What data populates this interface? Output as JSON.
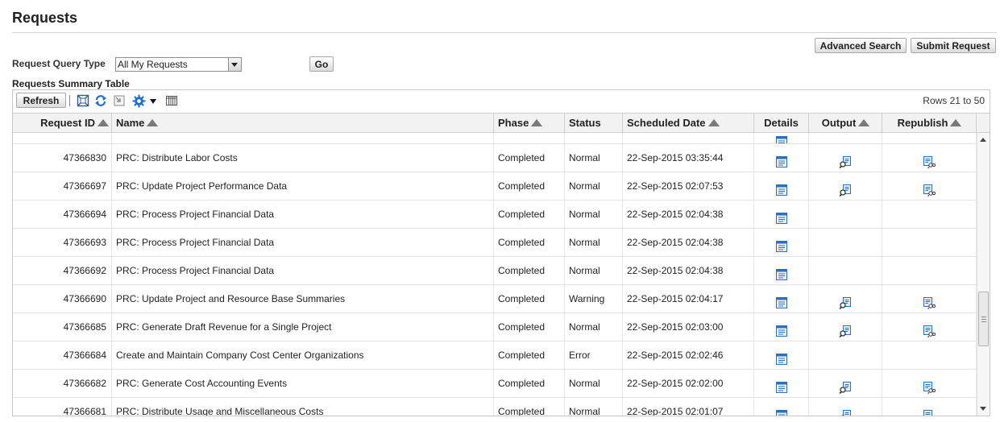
{
  "page": {
    "title": "Requests"
  },
  "actions": {
    "advanced_search": "Advanced Search",
    "submit_request": "Submit Request"
  },
  "query": {
    "label": "Request Query Type",
    "selected": "All My Requests",
    "go_label": "Go"
  },
  "table": {
    "title": "Requests Summary Table",
    "refresh_label": "Refresh",
    "rows_range": "Rows 21 to 50",
    "columns": {
      "request_id": "Request ID",
      "name": "Name",
      "phase": "Phase",
      "status": "Status",
      "scheduled_date": "Scheduled Date",
      "details": "Details",
      "output": "Output",
      "republish": "Republish"
    },
    "rows": [
      {
        "request_id": "47366830",
        "name": "PRC: Distribute Labor Costs",
        "phase": "Completed",
        "status": "Normal",
        "scheduled_date": "22-Sep-2015 03:35:44",
        "has_output": true,
        "has_republish": true
      },
      {
        "request_id": "47366697",
        "name": "PRC: Update Project Performance Data",
        "phase": "Completed",
        "status": "Normal",
        "scheduled_date": "22-Sep-2015 02:07:53",
        "has_output": true,
        "has_republish": true
      },
      {
        "request_id": "47366694",
        "name": "PRC: Process Project Financial Data",
        "phase": "Completed",
        "status": "Normal",
        "scheduled_date": "22-Sep-2015 02:04:38",
        "has_output": false,
        "has_republish": false
      },
      {
        "request_id": "47366693",
        "name": "PRC: Process Project Financial Data",
        "phase": "Completed",
        "status": "Normal",
        "scheduled_date": "22-Sep-2015 02:04:38",
        "has_output": false,
        "has_republish": false
      },
      {
        "request_id": "47366692",
        "name": "PRC: Process Project Financial Data",
        "phase": "Completed",
        "status": "Normal",
        "scheduled_date": "22-Sep-2015 02:04:38",
        "has_output": false,
        "has_republish": false
      },
      {
        "request_id": "47366690",
        "name": "PRC: Update Project and Resource Base Summaries",
        "phase": "Completed",
        "status": "Warning",
        "scheduled_date": "22-Sep-2015 02:04:17",
        "has_output": true,
        "has_republish": true
      },
      {
        "request_id": "47366685",
        "name": "PRC: Generate Draft Revenue for a Single Project",
        "phase": "Completed",
        "status": "Normal",
        "scheduled_date": "22-Sep-2015 02:03:00",
        "has_output": true,
        "has_republish": true
      },
      {
        "request_id": "47366684",
        "name": "Create and Maintain Company Cost Center Organizations",
        "phase": "Completed",
        "status": "Error",
        "scheduled_date": "22-Sep-2015 02:02:46",
        "has_output": false,
        "has_republish": false
      },
      {
        "request_id": "47366682",
        "name": "PRC: Generate Cost Accounting Events",
        "phase": "Completed",
        "status": "Normal",
        "scheduled_date": "22-Sep-2015 02:02:00",
        "has_output": true,
        "has_republish": true
      },
      {
        "request_id": "47366681",
        "name": "PRC: Distribute Usage and Miscellaneous Costs",
        "phase": "Completed",
        "status": "Normal",
        "scheduled_date": "22-Sep-2015 02:01:07",
        "has_output": true,
        "has_republish": true
      }
    ]
  },
  "colors": {
    "header_bg": "#f2f2f2",
    "icon_blue": "#2d6fb8",
    "border": "#c8c8c8"
  }
}
